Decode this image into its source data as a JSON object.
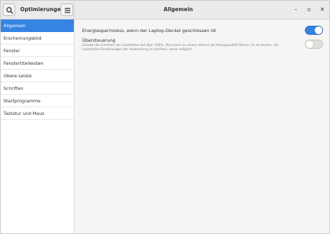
{
  "header": {
    "sidebar_title": "Optimierungen",
    "main_title": "Allgemein",
    "minimize_glyph": "–",
    "maximize_glyph": "▫",
    "close_glyph": "✕"
  },
  "sidebar": {
    "items": [
      {
        "label": "Allgemein",
        "selected": true
      },
      {
        "label": "Erscheinungsbild",
        "selected": false
      },
      {
        "label": "Fenster",
        "selected": false
      },
      {
        "label": "Fenstertitelleisten",
        "selected": false
      },
      {
        "label": "Obere Leiste",
        "selected": false
      },
      {
        "label": "Schriften",
        "selected": false
      },
      {
        "label": "Startprogramme",
        "selected": false
      },
      {
        "label": "Tastatur und Maus",
        "selected": false
      }
    ]
  },
  "settings": {
    "power_saving": {
      "label": "Energiesparmodus, wenn der Laptop-Deckel geschlossen ist",
      "enabled": true
    },
    "overamplification": {
      "label": "Übersteuerung",
      "description": "Erlaubt das Erhöhen der Lautstärke auf über 100%. Dies kann zu einem Verlust der Klangqualität führen; Es ist besser, die Lautstärke-Einstellungen der Anwendung zu erhöhen, wenn möglich.",
      "enabled": false
    }
  },
  "colors": {
    "accent": "#3584e4",
    "sidebar_bg": "#ffffff",
    "content_bg": "#f6f5f4",
    "header_bg": "#ebebeb"
  }
}
